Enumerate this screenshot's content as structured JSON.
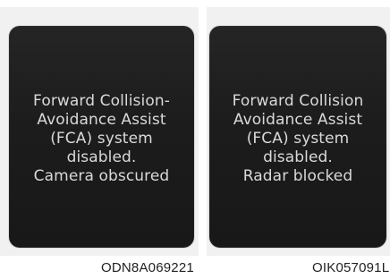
{
  "panels": [
    {
      "lines": [
        "Forward Collision-",
        "Avoidance Assist",
        "(FCA) system",
        "disabled.",
        "Camera obscured"
      ],
      "code": "ODN8A069221"
    },
    {
      "lines": [
        "Forward Collision",
        "Avoidance Assist",
        "(FCA) system",
        "disabled.",
        "Radar blocked"
      ],
      "code": "OIK057091L"
    }
  ]
}
